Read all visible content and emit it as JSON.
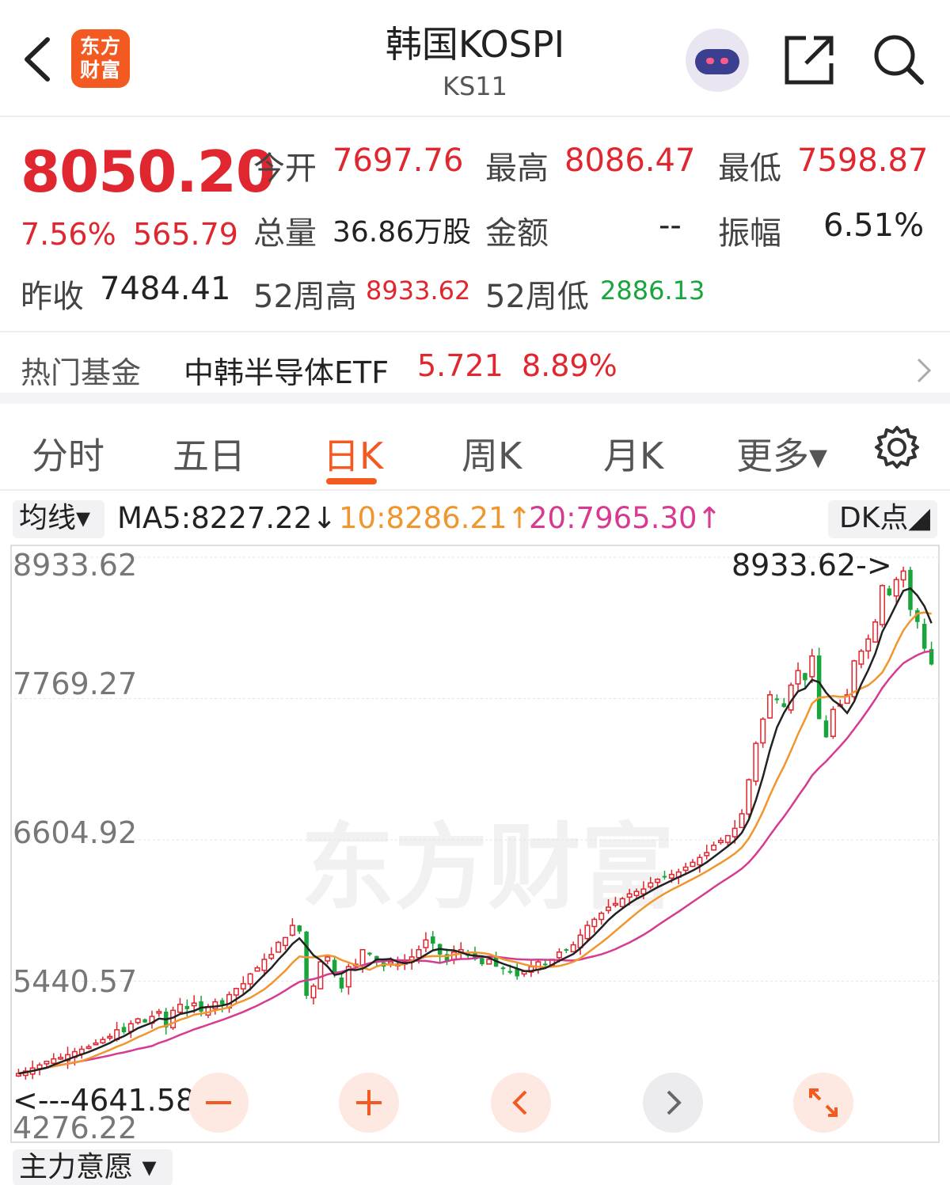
{
  "header": {
    "logo_text": "东方财富",
    "title": "韩国KOSPI",
    "subtitle": "KS11",
    "icons": [
      "back-arrow-icon",
      "robot-assistant-icon",
      "share-icon",
      "search-icon"
    ]
  },
  "quote": {
    "price": "8050.20",
    "change_pct": "7.56%",
    "change_abs": "565.79",
    "open_label": "今开",
    "open_value": "7697.76",
    "high_label": "最高",
    "high_value": "8086.47",
    "low_label": "最低",
    "low_value": "7598.87",
    "volume_label": "总量",
    "volume_value": "36.86万股",
    "amount_label": "金额",
    "amount_value": "--",
    "amplitude_label": "振幅",
    "amplitude_value": "6.51%",
    "prev_close_label": "昨收",
    "prev_close_value": "7484.41",
    "high52_label": "52周高",
    "high52_value": "8933.62",
    "low52_label": "52周低",
    "low52_value": "2886.13"
  },
  "hot_fund": {
    "label": "热门基金",
    "name": "中韩半导体ETF",
    "price": "5.721",
    "change": "8.89%"
  },
  "tabs": [
    {
      "label": "分时"
    },
    {
      "label": "五日"
    },
    {
      "label": "日K"
    },
    {
      "label": "周K"
    },
    {
      "label": "月K"
    },
    {
      "label": "更多▾"
    }
  ],
  "active_tab": "日K",
  "indicators": {
    "ma_select": "均线▾",
    "ma5": "MA5:8227.22↓",
    "ma10": "10:8286.21↑",
    "ma20": "20:7965.30↑",
    "dk_button": "DK点◢"
  },
  "chart_data": {
    "type": "candlestick",
    "y_ticks": [
      "8933.62",
      "7769.27",
      "6604.92",
      "5440.57",
      "4276.22"
    ],
    "ylim": [
      4276.22,
      8933.62
    ],
    "annotations": {
      "max_label": "8933.62->",
      "min_label": "<---4641.58"
    },
    "watermark": "东方财富",
    "colors": {
      "up": "#e0262e",
      "down": "#19a43c",
      "ma5": "#222222",
      "ma10": "#f0962e",
      "ma20": "#d63b91"
    },
    "closes": [
      4680,
      4700,
      4725,
      4750,
      4780,
      4800,
      4812,
      4835,
      4860,
      4880,
      4900,
      4930,
      4960,
      4985,
      5040,
      5020,
      5090,
      5130,
      5100,
      5150,
      5190,
      5060,
      5200,
      5250,
      5210,
      5260,
      5190,
      5230,
      5270,
      5250,
      5330,
      5380,
      5420,
      5500,
      5550,
      5620,
      5660,
      5760,
      5800,
      5900,
      5850,
      5320,
      5400,
      5600,
      5640,
      5500,
      5380,
      5560,
      5580,
      5700,
      5660,
      5600,
      5560,
      5600,
      5580,
      5600,
      5640,
      5700,
      5780,
      5750,
      5660,
      5600,
      5680,
      5700,
      5650,
      5620,
      5580,
      5620,
      5560,
      5540,
      5520,
      5480,
      5520,
      5560,
      5600,
      5580,
      5620,
      5680,
      5700,
      5740,
      5820,
      5900,
      5950,
      6000,
      6050,
      6080,
      6120,
      6160,
      6180,
      6200,
      6250,
      6280,
      6300,
      6320,
      6340,
      6380,
      6420,
      6460,
      6500,
      6560,
      6600,
      6640,
      6700,
      6820,
      7100,
      7400,
      7600,
      7800,
      7760,
      7700,
      7880,
      8000,
      7920,
      8120,
      7600,
      7450,
      7680,
      7720,
      7800,
      8080,
      8160,
      8260,
      8400,
      8700,
      8620,
      8750,
      8820,
      8500,
      8400,
      8180,
      8050
    ],
    "ma_lines": {
      "ma5": "black line",
      "ma10": "orange line",
      "ma20": "magenta line"
    }
  },
  "controls": [
    "zoom-out-icon",
    "zoom-in-icon",
    "scroll-left-icon",
    "scroll-right-icon",
    "expand-icon"
  ],
  "bottom_select": "主力意愿 ▾"
}
